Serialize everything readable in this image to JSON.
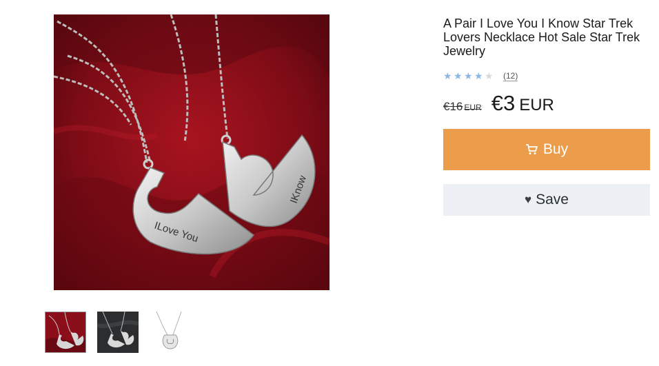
{
  "product": {
    "title": "A Pair I Love You I Know Star Trek Lovers Necklace Hot Sale Star Trek Jewelry",
    "rating": {
      "stars_filled": 4,
      "stars_total": 5,
      "review_count": "(12)"
    },
    "price": {
      "old_amount": "€16",
      "old_currency": "EUR",
      "new_amount": "€3",
      "new_currency": "EUR"
    },
    "image_engravings": {
      "left_pendant": "ILove You",
      "right_pendant": "IKnow"
    }
  },
  "actions": {
    "buy_label": "Buy",
    "buy_icon": "cart-icon",
    "save_label": "Save",
    "save_icon": "heart-icon"
  },
  "colors": {
    "buy_button": "#eb9d4c",
    "save_button": "#edf0f5",
    "star_filled": "#8bb8e0",
    "star_empty": "#d8d8d8"
  },
  "thumbnails": [
    {
      "name": "red-background"
    },
    {
      "name": "dark-background"
    },
    {
      "name": "white-background"
    }
  ]
}
